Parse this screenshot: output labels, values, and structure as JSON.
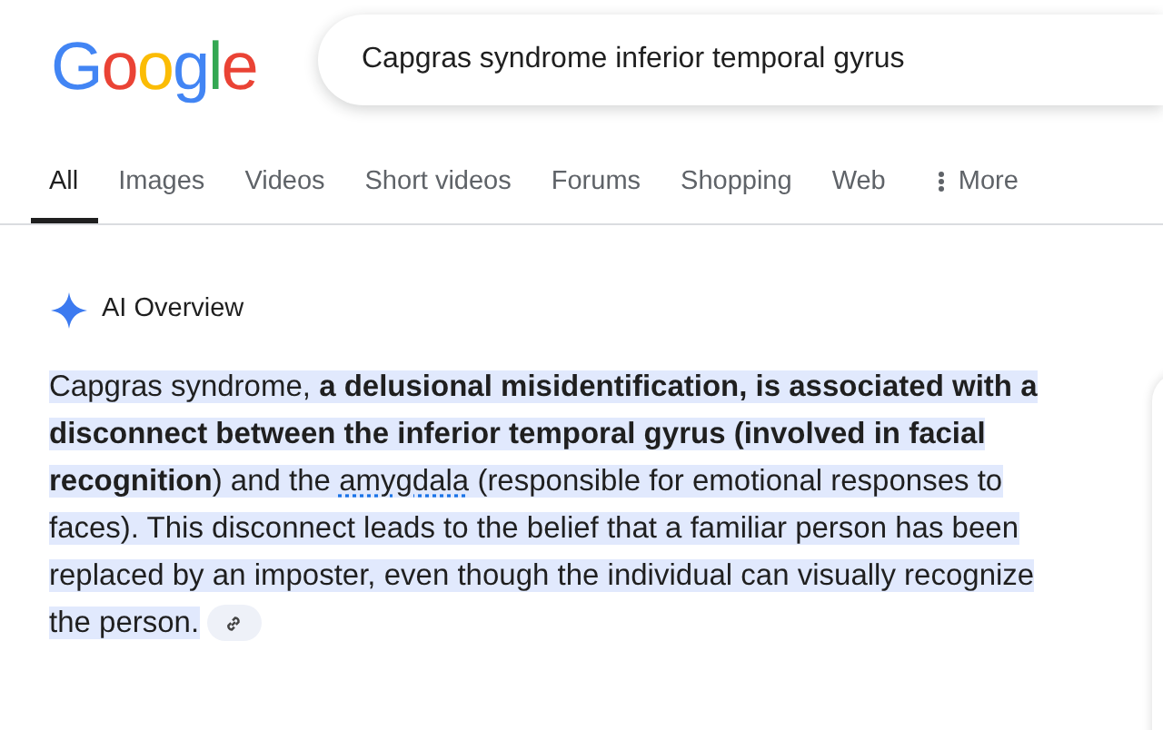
{
  "logo": {
    "letters": [
      {
        "char": "G",
        "color": "#4285f4"
      },
      {
        "char": "o",
        "color": "#ea4335"
      },
      {
        "char": "o",
        "color": "#fbbc05"
      },
      {
        "char": "g",
        "color": "#4285f4"
      },
      {
        "char": "l",
        "color": "#34a853"
      },
      {
        "char": "e",
        "color": "#ea4335"
      }
    ]
  },
  "search": {
    "value": "Capgras syndrome inferior temporal gyrus"
  },
  "tabs": [
    {
      "label": "All",
      "selected": true,
      "kind": "tab"
    },
    {
      "label": "Images",
      "selected": false,
      "kind": "tab"
    },
    {
      "label": "Videos",
      "selected": false,
      "kind": "tab"
    },
    {
      "label": "Short videos",
      "selected": false,
      "kind": "tab"
    },
    {
      "label": "Forums",
      "selected": false,
      "kind": "tab"
    },
    {
      "label": "Shopping",
      "selected": false,
      "kind": "tab"
    },
    {
      "label": "Web",
      "selected": false,
      "kind": "tab"
    },
    {
      "label": "More",
      "selected": false,
      "kind": "menu"
    }
  ],
  "ai_overview": {
    "title": "AI Overview",
    "segments": [
      {
        "kind": "plain",
        "text": "Capgras syndrome, "
      },
      {
        "kind": "bold",
        "text": "a delusional misidentification, is associated with a disconnect between the inferior temporal gyrus (involved in facial recognition"
      },
      {
        "kind": "plain",
        "text": ") and the "
      },
      {
        "kind": "term",
        "text": "amygdala"
      },
      {
        "kind": "plain",
        "text": " (responsible for emotional responses to faces). This disconnect leads to the belief that a familiar person has been replaced by an imposter, even though the individual can visually recognize the person."
      }
    ],
    "source_link": true
  }
}
